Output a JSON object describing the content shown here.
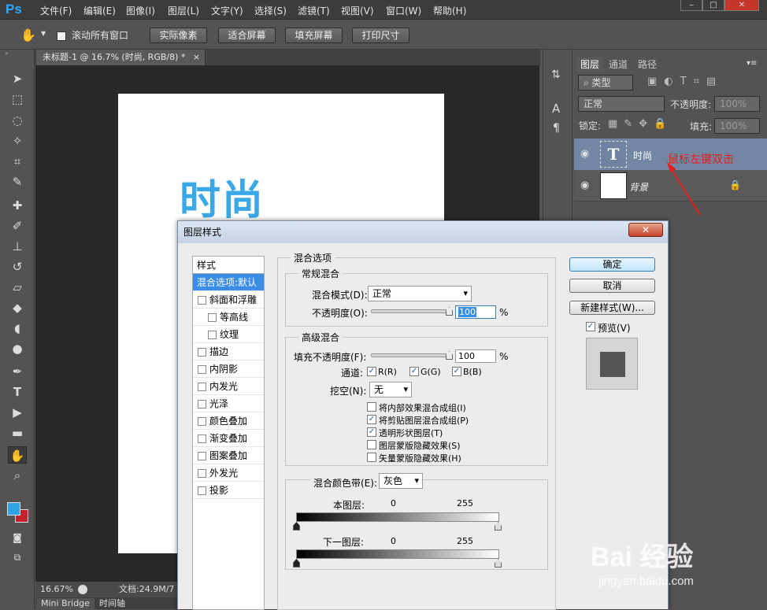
{
  "app": {
    "logo": "Ps"
  },
  "menu": [
    "文件(F)",
    "编辑(E)",
    "图像(I)",
    "图层(L)",
    "文字(Y)",
    "选择(S)",
    "滤镜(T)",
    "视图(V)",
    "窗口(W)",
    "帮助(H)"
  ],
  "window_buttons": {
    "minimize": "‒",
    "restore": "□",
    "close": "✕"
  },
  "options": {
    "scroll_all_label": "滚动所有窗口",
    "actual_pixels": "实际像素",
    "fit_screen": "适合屏幕",
    "fill_screen": "填充屏幕",
    "print_size": "打印尺寸"
  },
  "document": {
    "tab_title": "未标题-1 @ 16.7% (时尚, RGB/8) *",
    "tab_close": "×",
    "canvas_text": "时尚",
    "zoom": "16.67%",
    "doc_info": "文档:24.9M/7"
  },
  "bottom_tabs": [
    "Mini Bridge",
    "时间轴"
  ],
  "layers_panel": {
    "tabs": [
      "图层",
      "通道",
      "路径"
    ],
    "filter_kind": "类型",
    "blend_mode": "正常",
    "opacity_label": "不透明度:",
    "opacity_value": "100%",
    "lock_label": "锁定:",
    "fill_label": "填充:",
    "fill_value": "100%",
    "layers": [
      {
        "name": "时尚",
        "thumb": "T"
      },
      {
        "name": "背景"
      }
    ]
  },
  "dialog": {
    "title": "图层样式",
    "close": "✕",
    "styles_header": "样式",
    "styles": [
      {
        "label": "混合选项:默认",
        "checkbox": false,
        "selected": true
      },
      {
        "label": "斜面和浮雕",
        "checkbox": true
      },
      {
        "label": "等高线",
        "checkbox": true,
        "indent": true
      },
      {
        "label": "纹理",
        "checkbox": true,
        "indent": true
      },
      {
        "label": "描边",
        "checkbox": true
      },
      {
        "label": "内阴影",
        "checkbox": true
      },
      {
        "label": "内发光",
        "checkbox": true
      },
      {
        "label": "光泽",
        "checkbox": true
      },
      {
        "label": "颜色叠加",
        "checkbox": true
      },
      {
        "label": "渐变叠加",
        "checkbox": true
      },
      {
        "label": "图案叠加",
        "checkbox": true
      },
      {
        "label": "外发光",
        "checkbox": true
      },
      {
        "label": "投影",
        "checkbox": true
      }
    ],
    "blend_options_title": "混合选项",
    "general_blending": "常规混合",
    "blend_mode_label": "混合模式(D):",
    "blend_mode_value": "正常",
    "opacity_label": "不透明度(O):",
    "opacity_value": "100",
    "percent": "%",
    "advanced_blending": "高级混合",
    "fill_opacity_label": "填充不透明度(F):",
    "fill_opacity_value": "100",
    "channels_label": "通道:",
    "channel_r": "R(R)",
    "channel_g": "G(G)",
    "channel_b": "B(B)",
    "knockout_label": "挖空(N):",
    "knockout_value": "无",
    "options": [
      {
        "label": "将内部效果混合成组(I)",
        "checked": false
      },
      {
        "label": "将剪贴图层混合成组(P)",
        "checked": true
      },
      {
        "label": "透明形状图层(T)",
        "checked": true
      },
      {
        "label": "图层蒙版隐藏效果(S)",
        "checked": false
      },
      {
        "label": "矢量蒙版隐藏效果(H)",
        "checked": false
      }
    ],
    "blend_if_label": "混合颜色带(E):",
    "blend_if_value": "灰色",
    "this_layer": "本图层:",
    "underlying_layer": "下一图层:",
    "range_min": "0",
    "range_max": "255",
    "ok": "确定",
    "cancel": "取消",
    "new_style": "新建样式(W)...",
    "preview_label": "预览(V)"
  },
  "annotation": "鼠标左键双击",
  "watermark": {
    "brand": "Bai  经验",
    "url": "jingyan.baidu.com"
  },
  "colors": {
    "accent": "#3b8ee8",
    "layer_selected": "#7287a4",
    "annotation": "#e21f1f",
    "canvas_text": "#3aa8e6"
  }
}
